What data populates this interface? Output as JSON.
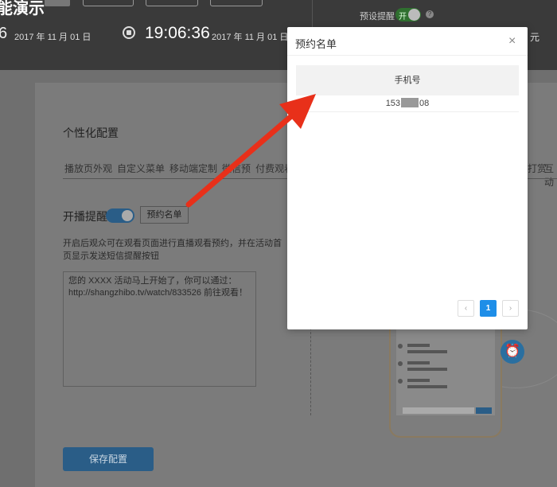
{
  "header": {
    "title_fragment": "能演示",
    "start_digit": "6",
    "start_date": "2017 年 11 月 01 日",
    "time": "19:06:36",
    "end_date": "2017 年 11 月 01 日",
    "remind_label": "预设提醒",
    "toggle_text": "开",
    "yuan": "元"
  },
  "config": {
    "section_title": "个性化配置",
    "tabs": [
      "播放页外观",
      "自定义菜单",
      "移动端定制",
      "微信预",
      "付费观看"
    ],
    "tab_right1": "打赏",
    "tab_right2": "互动",
    "remind_label": "开播提醒",
    "list_button": "预约名单",
    "description": "开启后观众可在观看页面进行直播观看预约，并在活动首页显示发送短信提醒按钮",
    "message": "您的 XXXX 活动马上开始了，你可以通过：http://shangzhibo.tv/watch/833526 前往观看！",
    "save_button": "保存配置"
  },
  "modal": {
    "title": "预约名单",
    "close": "×",
    "column_header": "手机号",
    "rows": [
      {
        "phone_prefix": "153",
        "phone_suffix": "08"
      }
    ],
    "pagination": {
      "prev": "‹",
      "current": "1",
      "next": "›"
    }
  },
  "colors": {
    "accent": "#1e8ee8",
    "arrow": "#e8301a"
  }
}
